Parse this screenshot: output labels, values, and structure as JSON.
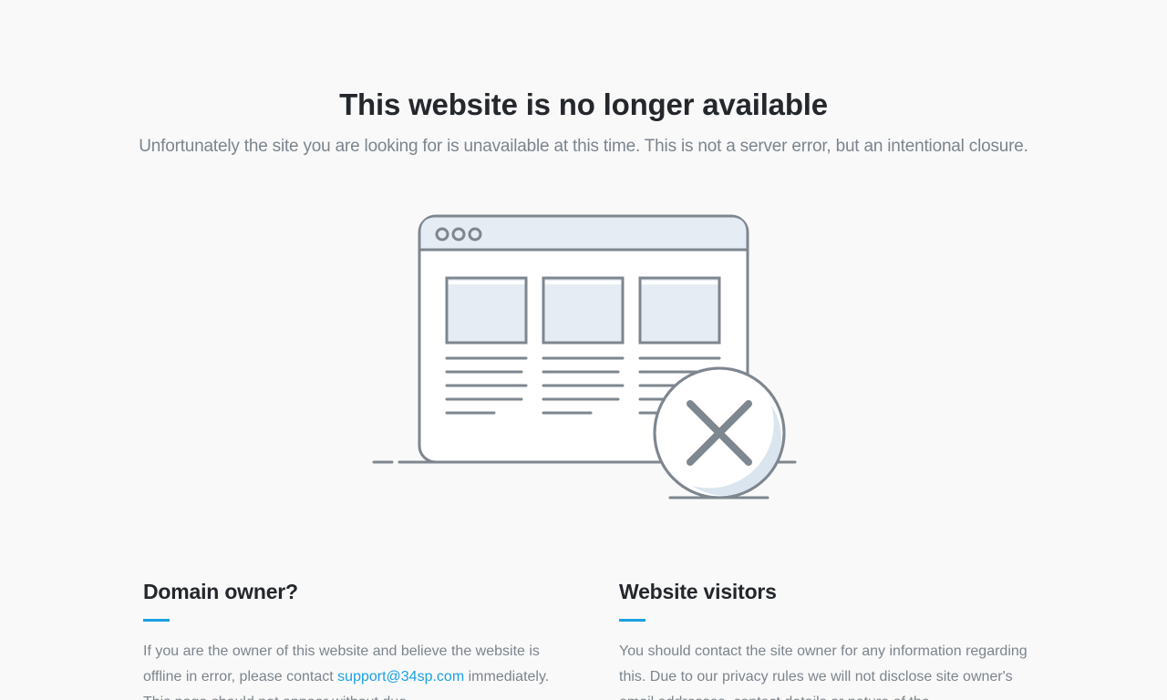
{
  "hero": {
    "title": "This website is no longer available",
    "subtitle": "Unfortunately the site you are looking for is unavailable at this time. This is not a server error, but an intentional closure."
  },
  "illustration": {
    "icon": "closed-browser-window-illustration",
    "colors": {
      "stroke": "#7e868f",
      "panel_fill": "#e5ecf4",
      "window_fill": "#ffffff",
      "badge_shadow": "#dbe5ef"
    }
  },
  "domain_owner": {
    "heading": "Domain owner?",
    "text_before_link": "If you are the owner of this website and believe the website is offline in error, please contact ",
    "link_text": "support@34sp.com",
    "text_after_link": " immediately. This page should not appear without due"
  },
  "website_visitors": {
    "heading": "Website visitors",
    "text": "You should contact the site owner for any information regarding this. Due to our privacy rules we will not disclose site owner's email addresses, contact details or nature of the"
  },
  "colors": {
    "accent": "#1ba0e2",
    "heading": "#24272b",
    "body_text": "#7c848d",
    "background": "#f9f9f9"
  }
}
